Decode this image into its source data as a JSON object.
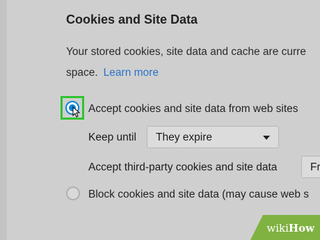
{
  "section": {
    "heading": "Cookies and Site Data",
    "desc_line1": "Your stored cookies, site data and cache are curre",
    "desc_line2": "space.",
    "learn_more": "Learn more"
  },
  "options": {
    "accept_label": "Accept cookies and site data from web sites",
    "keep_until_label": "Keep until",
    "keep_until_value": "They expire",
    "third_party_label": "Accept third-party cookies and site data",
    "third_party_value": "Fr",
    "block_label": "Block cookies and site data (may cause web s"
  },
  "watermark": {
    "brand": "wiki",
    "suffix": "How"
  },
  "colors": {
    "highlight": "#2fc42f",
    "link": "#2a73c6",
    "radio_checked": "#0a84d6",
    "watermark": "#7fb241"
  }
}
